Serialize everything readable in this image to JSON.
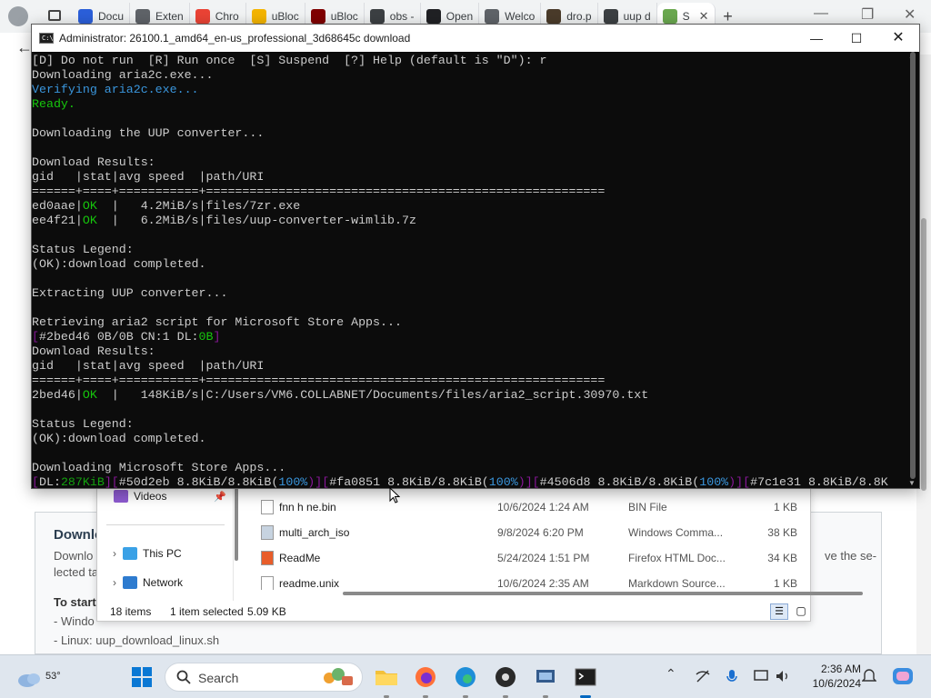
{
  "browser": {
    "tabs": [
      {
        "label": "Docu",
        "color": "#2b5fd9"
      },
      {
        "label": "Exten",
        "color": "#5f6368"
      },
      {
        "label": "Chro",
        "color": "#ea4335"
      },
      {
        "label": "uBloc",
        "color": "#f4b400"
      },
      {
        "label": "uBloc",
        "color": "#800000"
      },
      {
        "label": "obs -",
        "color": "#3c4043"
      },
      {
        "label": "Open",
        "color": "#202124"
      },
      {
        "label": "Welco",
        "color": "#5f6368"
      },
      {
        "label": "dro.p",
        "color": "#4a3b2a"
      },
      {
        "label": "uup d",
        "color": "#3c4043"
      },
      {
        "label": "S",
        "color": "#6aa84f"
      }
    ],
    "new_tab_label": "+",
    "active_tab_close": "✕"
  },
  "console": {
    "title": "Administrator:  26100.1_amd64_en-us_professional_3d68645c download",
    "lines": [
      [
        {
          "t": "[D] Do not run  [R] Run once  [S] Suspend  [?] Help (default is \"D\"): r",
          "c": ""
        }
      ],
      [
        {
          "t": "Downloading aria2c.exe...",
          "c": ""
        }
      ],
      [
        {
          "t": "Verifying aria2c.exe...",
          "c": "cy"
        }
      ],
      [
        {
          "t": "Ready.",
          "c": "g"
        }
      ],
      [
        {
          "t": "",
          "c": ""
        }
      ],
      [
        {
          "t": "Downloading the UUP converter...",
          "c": ""
        }
      ],
      [
        {
          "t": "",
          "c": ""
        }
      ],
      [
        {
          "t": "Download Results:",
          "c": ""
        }
      ],
      [
        {
          "t": "gid   |stat|avg speed  |path/URI",
          "c": ""
        }
      ],
      [
        {
          "t": "======+====+===========+=======================================================",
          "c": ""
        }
      ],
      [
        {
          "t": "ed0aae|",
          "c": ""
        },
        {
          "t": "OK",
          "c": "g"
        },
        {
          "t": "  |   4.2MiB/s|files/7zr.exe",
          "c": ""
        }
      ],
      [
        {
          "t": "ee4f21|",
          "c": ""
        },
        {
          "t": "OK",
          "c": "g"
        },
        {
          "t": "  |   6.2MiB/s|files/uup-converter-wimlib.7z",
          "c": ""
        }
      ],
      [
        {
          "t": "",
          "c": ""
        }
      ],
      [
        {
          "t": "Status Legend:",
          "c": ""
        }
      ],
      [
        {
          "t": "(OK):download completed.",
          "c": ""
        }
      ],
      [
        {
          "t": "",
          "c": ""
        }
      ],
      [
        {
          "t": "Extracting UUP converter...",
          "c": ""
        }
      ],
      [
        {
          "t": "",
          "c": ""
        }
      ],
      [
        {
          "t": "Retrieving aria2 script for Microsoft Store Apps...",
          "c": ""
        }
      ],
      [
        {
          "t": "[",
          "c": "mg"
        },
        {
          "t": "#2bed46 0B/0B CN:1 DL:",
          "c": ""
        },
        {
          "t": "0B",
          "c": "g"
        },
        {
          "t": "]",
          "c": "mg"
        }
      ],
      [
        {
          "t": "Download Results:",
          "c": ""
        }
      ],
      [
        {
          "t": "gid   |stat|avg speed  |path/URI",
          "c": ""
        }
      ],
      [
        {
          "t": "======+====+===========+=======================================================",
          "c": ""
        }
      ],
      [
        {
          "t": "2bed46|",
          "c": ""
        },
        {
          "t": "OK",
          "c": "g"
        },
        {
          "t": "  |   148KiB/s|C:/Users/VM6.COLLABNET/Documents/files/aria2_script.30970.txt",
          "c": ""
        }
      ],
      [
        {
          "t": "",
          "c": ""
        }
      ],
      [
        {
          "t": "Status Legend:",
          "c": ""
        }
      ],
      [
        {
          "t": "(OK):download completed.",
          "c": ""
        }
      ],
      [
        {
          "t": "",
          "c": ""
        }
      ],
      [
        {
          "t": "Downloading Microsoft Store Apps...",
          "c": ""
        }
      ],
      [
        {
          "t": "[",
          "c": "mg"
        },
        {
          "t": "DL:",
          "c": ""
        },
        {
          "t": "287KiB",
          "c": "gn"
        },
        {
          "t": "][",
          "c": "mg"
        },
        {
          "t": "#50d2eb 8.8KiB/8.8KiB(",
          "c": ""
        },
        {
          "t": "100%",
          "c": "cy"
        },
        {
          "t": ")][",
          "c": "mg"
        },
        {
          "t": "#fa0851 8.8KiB/8.8KiB(",
          "c": ""
        },
        {
          "t": "100%",
          "c": "cy"
        },
        {
          "t": ")][",
          "c": "mg"
        },
        {
          "t": "#4506d8 8.8KiB/8.8KiB(",
          "c": ""
        },
        {
          "t": "100%",
          "c": "cy"
        },
        {
          "t": ")][",
          "c": "mg"
        },
        {
          "t": "#7c1e31 8.8KiB/8.8K",
          "c": ""
        }
      ]
    ]
  },
  "explorer": {
    "nav": {
      "videos": "Videos",
      "this_pc": "This PC",
      "network": "Network"
    },
    "files": [
      {
        "name": "fnn h ne.bin",
        "date": "10/6/2024 1:24 AM",
        "type": "BIN File",
        "size": "1 KB"
      },
      {
        "name": "multi_arch_iso",
        "date": "9/8/2024 6:20 PM",
        "type": "Windows Comma...",
        "size": "38 KB"
      },
      {
        "name": "ReadMe",
        "date": "5/24/2024 1:51 PM",
        "type": "Firefox HTML Doc...",
        "size": "34 KB"
      },
      {
        "name": "readme.unix",
        "date": "10/6/2024 2:35 AM",
        "type": "Markdown Source...",
        "size": "1 KB"
      }
    ],
    "status": {
      "items": "18 items",
      "selected": "1 item selected",
      "size": "5.09 KB"
    }
  },
  "page": {
    "card_title": "Downlo",
    "card_desc_left": "Downlo",
    "card_desc_left2": "lected ta",
    "card_desc_right": "ve the se-",
    "card_start": "To start",
    "card_windows": "- Windo",
    "card_linux": "- Linux: uup_download_linux.sh"
  },
  "taskbar": {
    "weather_temp": "53°",
    "search_label": "Search",
    "time": "2:36 AM",
    "date": "10/6/2024"
  }
}
